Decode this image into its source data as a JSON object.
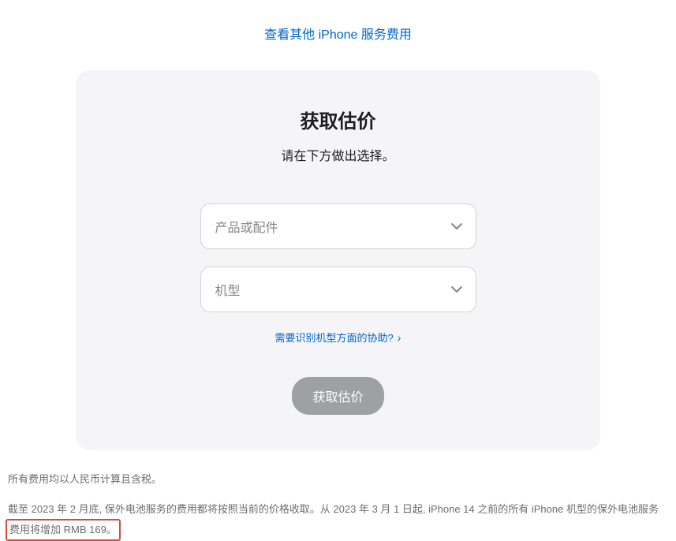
{
  "topLink": "查看其他 iPhone 服务费用",
  "card": {
    "title": "获取估价",
    "subtitle": "请在下方做出选择。",
    "select1Placeholder": "产品或配件",
    "select2Placeholder": "机型",
    "helpLink": "需要识别机型方面的协助?",
    "submitLabel": "获取估价"
  },
  "footnotes": {
    "line1": "所有费用均以人民币计算且含税。",
    "line2a": "截至 2023 年 2 月底, 保外电池服务的费用都将按照当前的价格收取。从 2023 年 3 月 1 日起, iPhone 14 之前的所有 iPhone 机型的保外电池服务",
    "line2b": "费用将增加 RMB 169。"
  }
}
